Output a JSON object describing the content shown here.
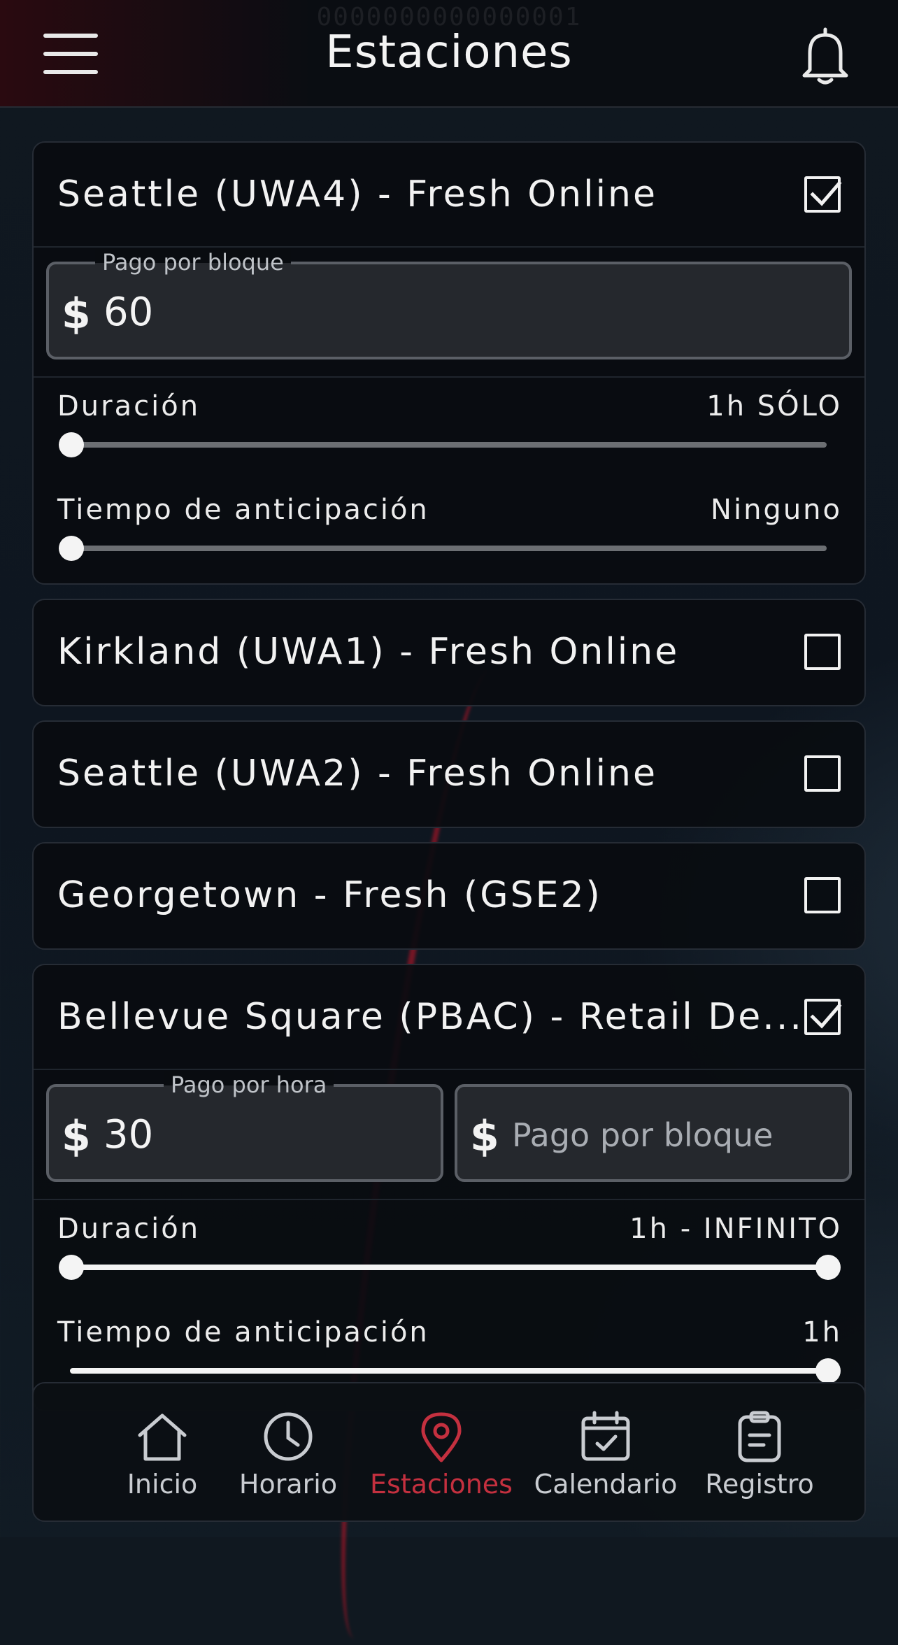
{
  "header": {
    "counter": "0000000000000001",
    "title": "Estaciones"
  },
  "stations": [
    {
      "name": "Seattle (UWA4) - Fresh Online",
      "checked": true,
      "pay_label": "Pago por bloque",
      "pay_currency": "$",
      "pay_value": "60",
      "duration_label": "Duración",
      "duration_value": "1h SÓLO",
      "duration_slider": 0,
      "advance_label": "Tiempo de anticipación",
      "advance_value": "Ninguno",
      "advance_slider": 0
    },
    {
      "name": "Kirkland (UWA1) - Fresh Online",
      "checked": false
    },
    {
      "name": "Seattle (UWA2) - Fresh Online",
      "checked": false
    },
    {
      "name": "Georgetown - Fresh (GSE2)",
      "checked": false
    },
    {
      "name": "Bellevue Square (PBAC) - Retail De...",
      "checked": true,
      "hourly_label": "Pago por hora",
      "hourly_currency": "$",
      "hourly_value": "30",
      "block_currency": "$",
      "block_placeholder": "Pago por bloque",
      "duration_label": "Duración",
      "duration_value": "1h - INFINITO",
      "duration_range": [
        0,
        1
      ],
      "advance_label": "Tiempo de anticipación",
      "advance_value": "1h",
      "advance_slider": 1
    }
  ],
  "bottom_nav": [
    {
      "label": "Inicio",
      "icon": "home-icon",
      "active": false
    },
    {
      "label": "Horario",
      "icon": "clock-icon",
      "active": false
    },
    {
      "label": "Estaciones",
      "icon": "map-pin-icon",
      "active": true
    },
    {
      "label": "Calendario",
      "icon": "calendar-check-icon",
      "active": false
    },
    {
      "label": "Registro",
      "icon": "clipboard-icon",
      "active": false
    }
  ],
  "colors": {
    "accent": "#c4303f",
    "text": "#f2f2f2",
    "card_bg": "#090c10",
    "field_bg": "#25282d",
    "track_off": "#6c6f73"
  }
}
